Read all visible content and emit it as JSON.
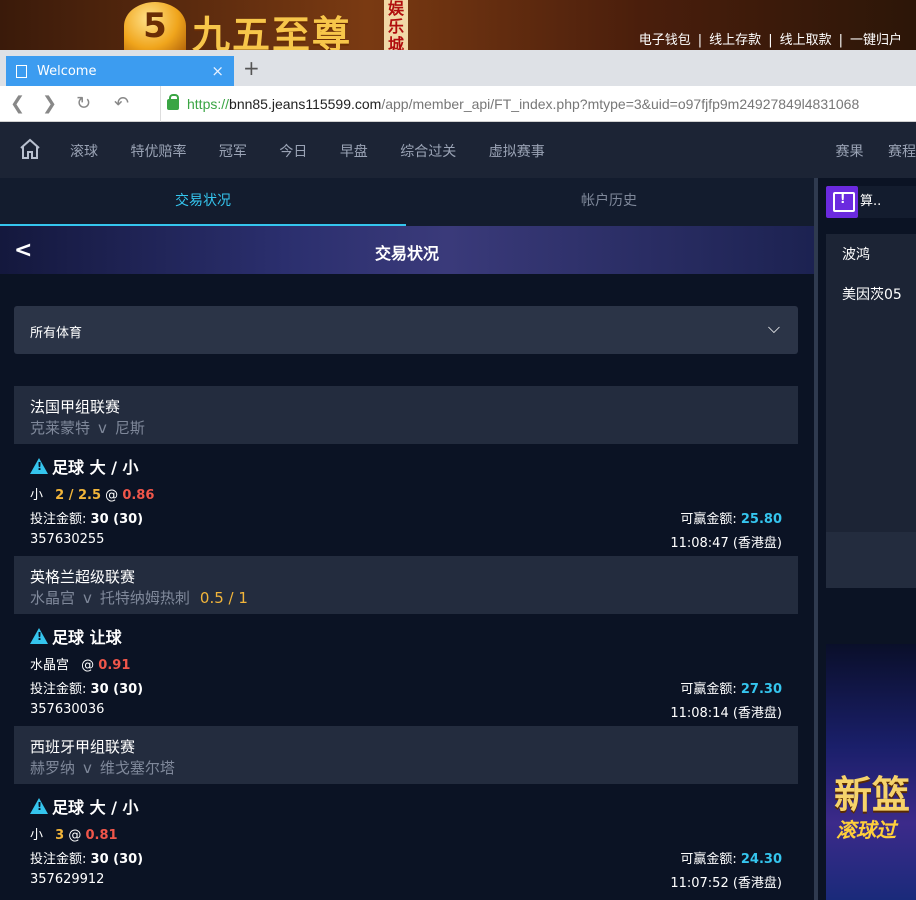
{
  "site": {
    "logo_number": "5",
    "logo_text": "九五至尊",
    "logo_vertical": [
      "娱",
      "乐",
      "城"
    ],
    "top_links": [
      "电子钱包",
      "线上存款",
      "线上取款",
      "一键归户"
    ]
  },
  "browser": {
    "tab_title": "Welcome",
    "url_protocol": "https://",
    "url_host": "bnn85.jeans115599.com",
    "url_path": "/app/member_api/FT_index.php?mtype=3&uid=o97fjfp9m24927849l4831068"
  },
  "nav": {
    "items": [
      "滚球",
      "特优赔率",
      "冠军",
      "今日",
      "早盘",
      "综合过关",
      "虚拟赛事"
    ],
    "right_items": [
      "赛果",
      "赛程"
    ]
  },
  "subtabs": [
    "交易状况",
    "帐户历史"
  ],
  "header": {
    "title": "交易状况"
  },
  "filter": {
    "selected": "所有体育"
  },
  "bets": [
    {
      "league": "法国甲组联赛",
      "home": "克莱蒙特",
      "vs": "v",
      "away": "尼斯",
      "handicap": "",
      "title": "足球 大 / 小",
      "pick": "小",
      "line": "2 / 2.5",
      "at": "@",
      "odds": "0.86",
      "stake_label": "投注金额:",
      "stake": "30 (30)",
      "win_label": "可赢金额:",
      "win": "25.80",
      "ticket": "357630255",
      "time": "11:08:47 (香港盘)"
    },
    {
      "league": "英格兰超级联赛",
      "home": "水晶宫",
      "vs": "v",
      "away": "托特纳姆热刺",
      "handicap": "0.5 / 1",
      "title": "足球 让球",
      "pick": "水晶宫",
      "line": "",
      "at": "@",
      "odds": "0.91",
      "stake_label": "投注金额:",
      "stake": "30 (30)",
      "win_label": "可赢金额:",
      "win": "27.30",
      "ticket": "357630036",
      "time": "11:08:14 (香港盘)"
    },
    {
      "league": "西班牙甲组联赛",
      "home": "赫罗纳",
      "vs": "v",
      "away": "维戈塞尔塔",
      "handicap": "",
      "title": "足球 大 / 小",
      "pick": "小",
      "line": "3",
      "at": "@",
      "odds": "0.81",
      "stake_label": "投注金额:",
      "stake": "30 (30)",
      "win_label": "可赢金额:",
      "win": "24.30",
      "ticket": "357629912",
      "time": "11:07:52 (香港盘)"
    }
  ],
  "right_pane": {
    "chat_label": "算..",
    "items": [
      "波鸿",
      "美因茨05"
    ],
    "promo_line1": "新篮",
    "promo_line2": "滚球过"
  },
  "colors": {
    "accent": "#35c5ee",
    "odds": "#f0564a",
    "line": "#f2b53a",
    "chat": "#6b2adf"
  }
}
